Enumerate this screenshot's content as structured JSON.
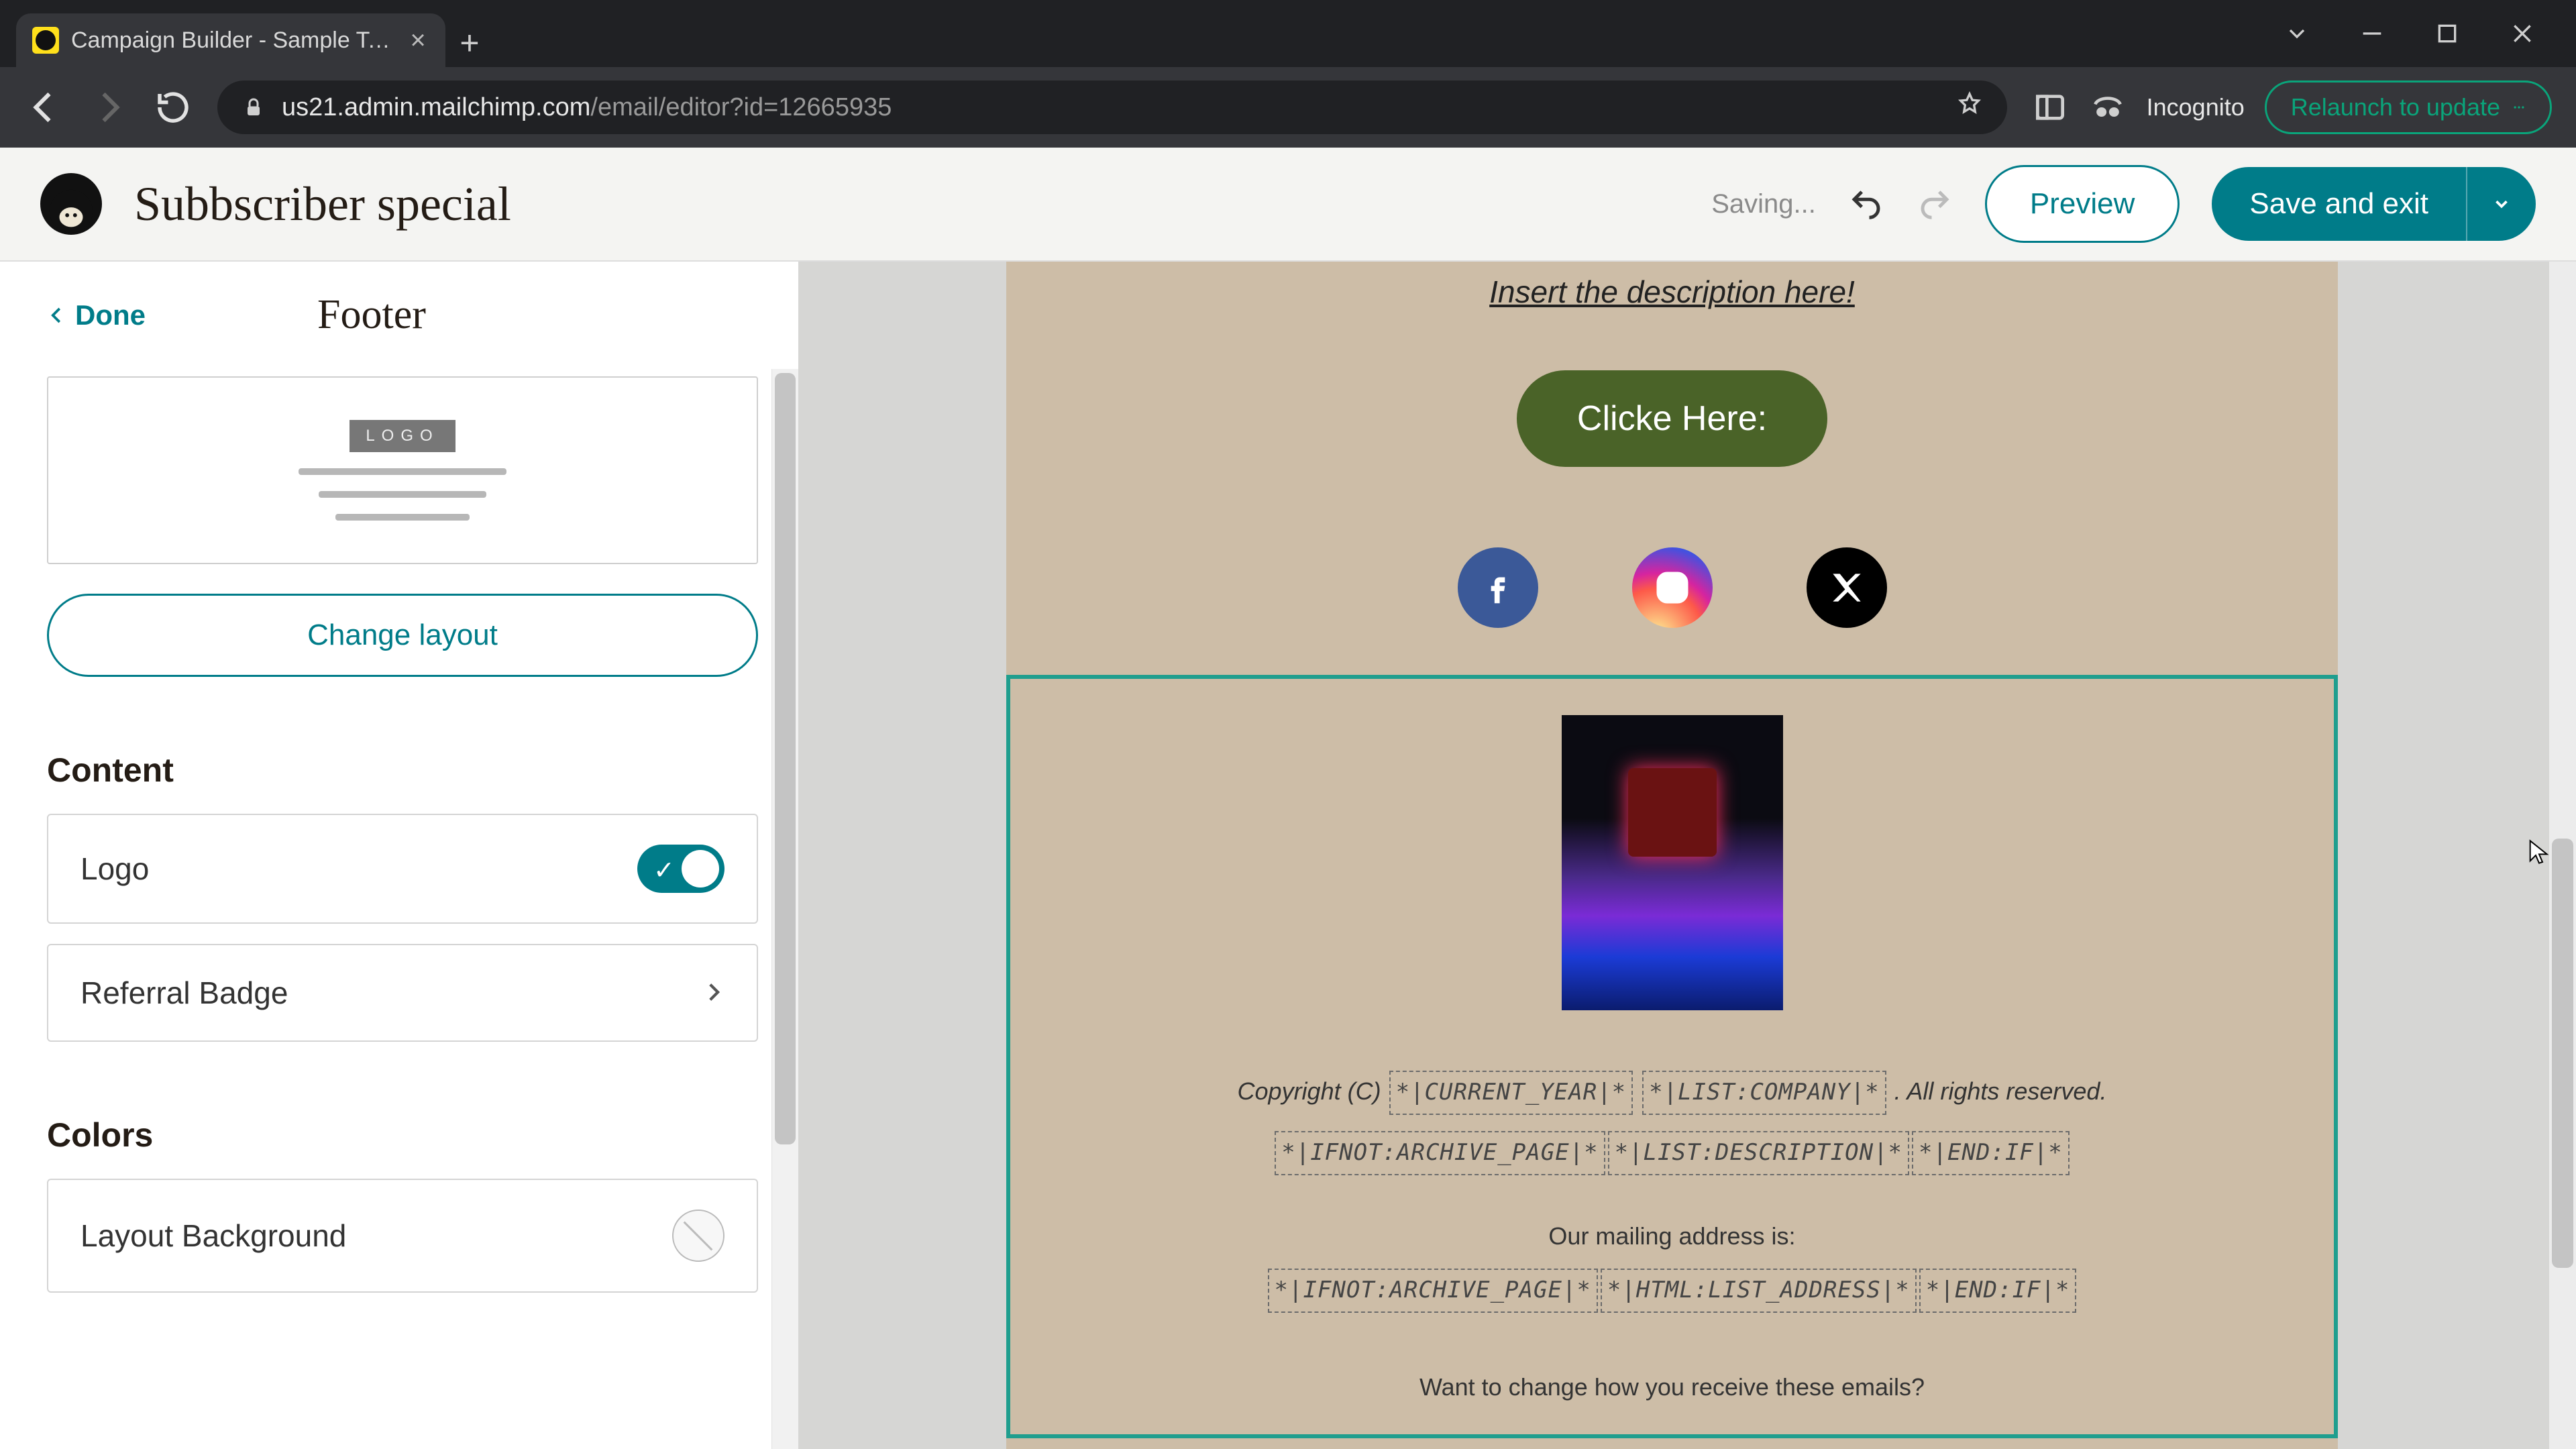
{
  "browser": {
    "tab_title": "Campaign Builder - Sample Tem",
    "url_host": "us21.admin.mailchimp.com",
    "url_path": "/email/editor?id=12665935",
    "incognito_label": "Incognito",
    "relaunch_label": "Relaunch to update"
  },
  "app_bar": {
    "campaign_name": "Subbscriber special",
    "saving_label": "Saving...",
    "preview_label": "Preview",
    "save_exit_label": "Save and exit"
  },
  "sidebar": {
    "done_label": "Done",
    "panel_title": "Footer",
    "layout_chip": "LOGO",
    "change_layout_label": "Change layout",
    "content_title": "Content",
    "logo_label": "Logo",
    "referral_label": "Referral Badge",
    "colors_title": "Colors",
    "layout_bg_label": "Layout Background"
  },
  "email": {
    "description": "Insert the description here!",
    "cta_label": "Clicke Here:",
    "footer": {
      "copyright_prefix": "Copyright (C)",
      "tag_year": "*|CURRENT_YEAR|*",
      "tag_company": "*|LIST:COMPANY|*",
      "rights": ". All rights reserved.",
      "tag_ifnot": "*|IFNOT:ARCHIVE_PAGE|*",
      "tag_listdesc": "*|LIST:DESCRIPTION|*",
      "tag_endif": "*|END:IF|*",
      "mailing_label": "Our mailing address is:",
      "tag_addr": "*|HTML:LIST_ADDRESS|*",
      "change_q": "Want to change how you receive these emails?"
    }
  }
}
